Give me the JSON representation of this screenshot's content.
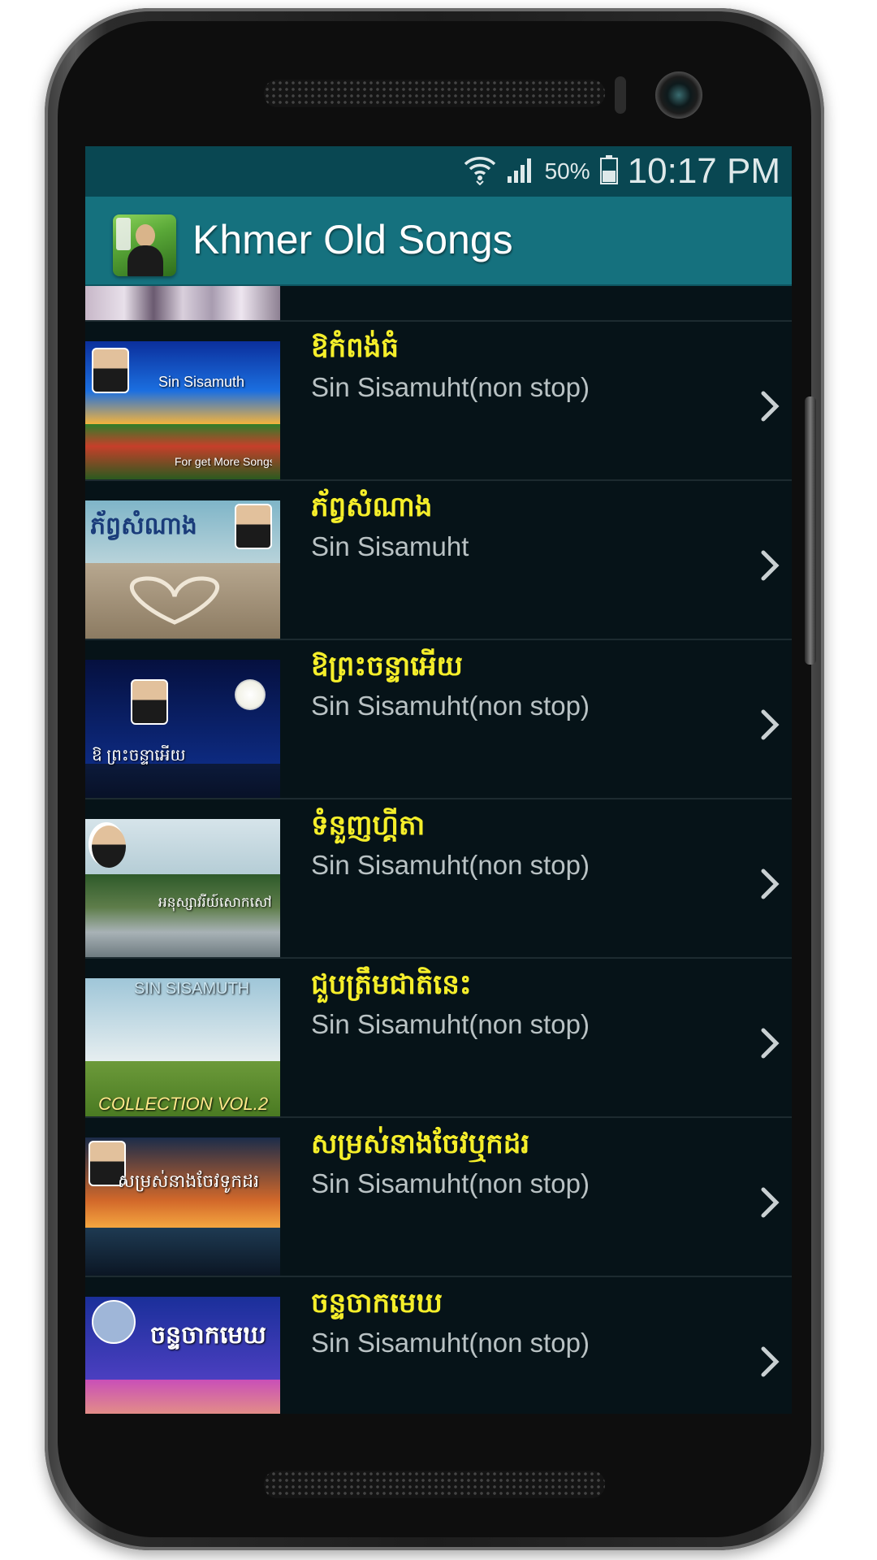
{
  "status_bar": {
    "battery_percent": "50%",
    "time": "10:17 PM",
    "icons": [
      "wifi-icon",
      "signal-icon",
      "battery-icon"
    ]
  },
  "app_bar": {
    "title": "Khmer Old Songs",
    "icon": "app-logo-icon"
  },
  "colors": {
    "status_bar": "#094752",
    "app_bar": "#15717e",
    "list_background": "#061318",
    "song_title": "#f5ee2a",
    "song_artist": "#b9c2c4"
  },
  "songs": [
    {
      "title": "ឱកំពង់ធំ",
      "artist": "Sin Sisamuht(non stop)",
      "thumb_captions": [
        "Sin Sisamuth",
        "For get More Songs"
      ]
    },
    {
      "title": "ភ័ព្វសំណាង",
      "artist": "Sin Sisamuht",
      "thumb_captions": [
        "ភ័ព្វសំណាង"
      ]
    },
    {
      "title": "ឱព្រះចន្ទាអើយ",
      "artist": "Sin Sisamuht(non stop)",
      "thumb_captions": [
        "ឱ ព្រះចន្ទាអើយ"
      ]
    },
    {
      "title": "ទំនួញហ្គីតា",
      "artist": "Sin Sisamuht(non stop)",
      "thumb_captions": [
        "អនុស្សាវរីយ៍សោកសៅ"
      ]
    },
    {
      "title": "ជួបត្រឹមជាតិនេះ",
      "artist": "Sin Sisamuht(non stop)",
      "thumb_captions": [
        "SIN SISAMUTH",
        "COLLECTION VOL.2"
      ]
    },
    {
      "title": "សម្រស់នាងចែវឬកដរ",
      "artist": "Sin Sisamuht(non stop)",
      "thumb_captions": [
        "សម្រស់នាងចែវទូកដរ"
      ]
    },
    {
      "title": "ចន្ទចាកមេឃ",
      "artist": "Sin Sisamuht(non stop)",
      "thumb_captions": [
        "ចន្ទចាកមេឃ"
      ]
    }
  ]
}
